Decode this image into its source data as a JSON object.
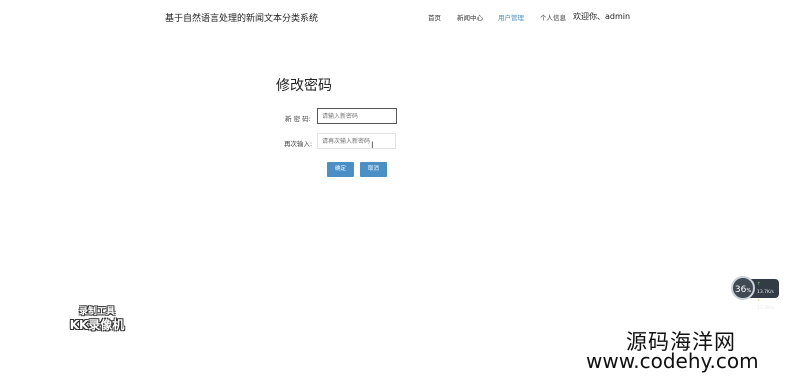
{
  "header": {
    "site_title": "基于自然语言处理的新闻文本分类系统",
    "nav": [
      {
        "label": "首页",
        "active": false
      },
      {
        "label": "新闻中心",
        "active": false
      },
      {
        "label": "用户管理",
        "active": true
      },
      {
        "label": "个人信息",
        "active": false
      }
    ],
    "welcome": "欢迎你、admin"
  },
  "form": {
    "title": "修改密码",
    "new_password": {
      "label": "新 密 码:",
      "value": "",
      "placeholder": "请输入新密码"
    },
    "confirm_password": {
      "label": "再次输入:",
      "value": "",
      "placeholder": "请再次输入新密码"
    },
    "confirm_button": "确定",
    "cancel_button": "取消"
  },
  "overlays": {
    "perf_value": "36",
    "perf_unit": "%",
    "upload_rate": "13.7K/s",
    "download_rate": "13.3K/s",
    "recorder_line1": "录制工具",
    "recorder_line2": "KK录像机",
    "watermark_line1": "源码海洋网",
    "watermark_line2": "www.codehy.com"
  },
  "colors": {
    "accent": "#4a8fc6"
  }
}
